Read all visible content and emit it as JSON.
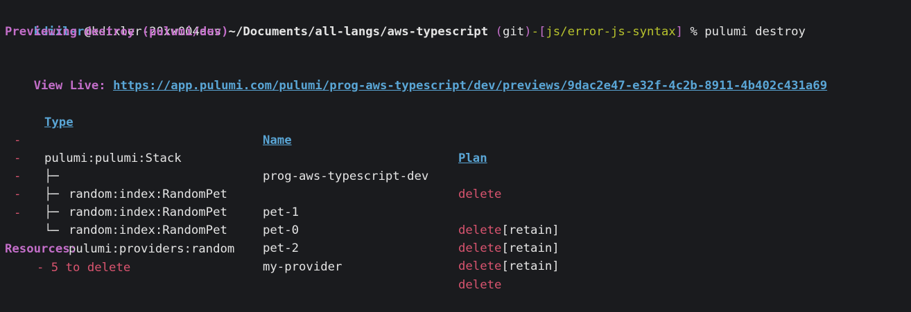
{
  "prompt": {
    "user": "kdixler",
    "host": "@kdixler-20xw004aus",
    "path": " ~/Documents/all-langs/aws-typescript",
    "git_open": " (",
    "git_label": "git",
    "git_close": ")",
    "branch_dash": "-",
    "branch_open": "[",
    "branch": "js/error-js-syntax",
    "branch_close": "]",
    "command": " % pulumi destroy"
  },
  "preview_line": "Previewing destroy (pulumi/dev)",
  "view_live": {
    "label": "View Live: ",
    "url": "https://app.pulumi.com/pulumi/prog-aws-typescript/dev/previews/9dac2e47-e32f-4c2b-8911-4b402c431a69"
  },
  "table": {
    "headers": {
      "type": "Type",
      "name": "Name",
      "plan": "Plan"
    },
    "rows": [
      {
        "op": "-",
        "tree": "",
        "type": "pulumi:pulumi:Stack",
        "name": "prog-aws-typescript-dev",
        "plan": "delete",
        "extra": ""
      },
      {
        "op": "-",
        "tree": "├─ ",
        "type": "random:index:RandomPet",
        "name": "pet-1",
        "plan": "delete",
        "extra": "[retain]"
      },
      {
        "op": "-",
        "tree": "├─ ",
        "type": "random:index:RandomPet",
        "name": "pet-0",
        "plan": "delete",
        "extra": "[retain]"
      },
      {
        "op": "-",
        "tree": "├─ ",
        "type": "random:index:RandomPet",
        "name": "pet-2",
        "plan": "delete",
        "extra": "[retain]"
      },
      {
        "op": "-",
        "tree": "└─ ",
        "type": "pulumi:providers:random",
        "name": "my-provider",
        "plan": "delete",
        "extra": ""
      }
    ]
  },
  "resources": {
    "label": "Resources:",
    "summary": "- 5 to delete"
  },
  "colors": {
    "background": "#1a1b1e",
    "text": "#e4e4e4",
    "blue": "#5aa6d6",
    "purple": "#c36ec9",
    "red": "#d9546f",
    "olive": "#b7c22d"
  }
}
